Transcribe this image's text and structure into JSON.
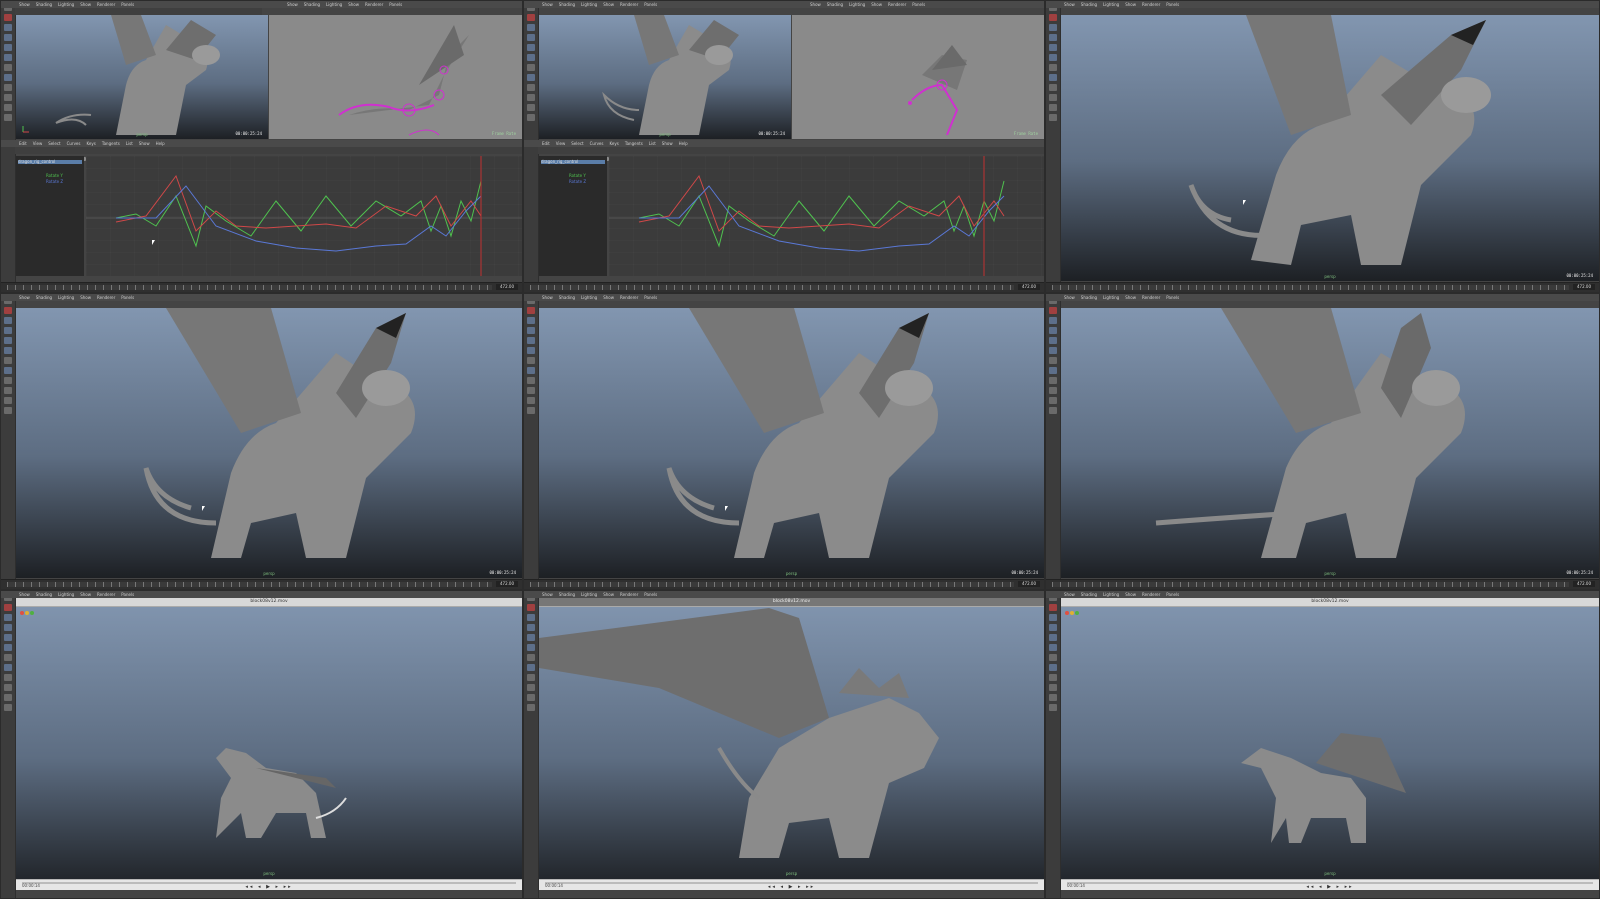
{
  "app": {
    "maya_menus": [
      "Show",
      "Shading",
      "Lighting",
      "Show",
      "Renderer",
      "Panels"
    ],
    "graph_editor_menus": [
      "Edit",
      "View",
      "Select",
      "Curves",
      "Keys",
      "Tangents",
      "List",
      "Show",
      "Help"
    ],
    "outliner_rows": [
      "dragon_rig_control",
      "Rotate Y",
      "Rotate Z"
    ],
    "hud_text": "00:00:25:24",
    "hud_label": "Frame Rate",
    "persp_label": "persp",
    "timeline_end": "472.00",
    "quicktime_title": "block08v12.mov",
    "qt_timecode": "00:00:14",
    "qt_controls": "◂◂ ◂ ▶ ▸ ▸▸"
  },
  "colors": {
    "curve_green": "#4fc24f",
    "curve_red": "#d04848",
    "curve_blue": "#5a78d6",
    "rig_magenta": "#d030d0",
    "hud_green": "#9fd29f"
  },
  "icons": {
    "axis": "axis-gizmo-icon",
    "cursor": "mouse-cursor-icon"
  }
}
